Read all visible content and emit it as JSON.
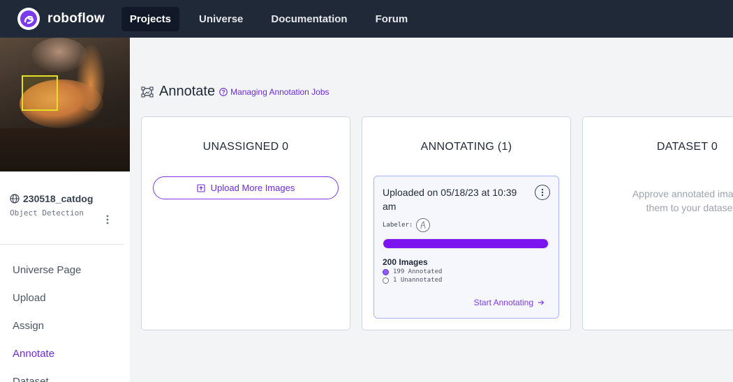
{
  "topbar": {
    "logo_text": "roboflow",
    "nav": [
      {
        "label": "Projects",
        "active": true
      },
      {
        "label": "Universe",
        "active": false
      },
      {
        "label": "Documentation",
        "active": false
      },
      {
        "label": "Forum",
        "active": false
      }
    ]
  },
  "sidebar": {
    "project_name": "230518_catdog",
    "project_type": "Object Detection",
    "menu": [
      {
        "label": "Universe Page",
        "active": false
      },
      {
        "label": "Upload",
        "active": false
      },
      {
        "label": "Assign",
        "active": false
      },
      {
        "label": "Annotate",
        "active": true
      },
      {
        "label": "Dataset",
        "active": false
      }
    ]
  },
  "main": {
    "title": "Annotate",
    "help_link": "Managing Annotation Jobs",
    "columns": {
      "unassigned": {
        "title": "UNASSIGNED 0",
        "upload_label": "Upload More Images"
      },
      "annotating": {
        "title": "ANNOTATING (1)",
        "job": {
          "title": "Uploaded on 05/18/23 at 10:39 am",
          "labeler_label": "Labeler:",
          "progress_fraction": 0.995,
          "images_label": "200 Images",
          "annotated_label": "199 Annotated",
          "unannotated_label": "1 Unannotated",
          "start_label": "Start Annotating"
        }
      },
      "dataset": {
        "title": "DATASET 0",
        "description_line1": "Approve annotated images",
        "description_line2": "them to your dataset"
      }
    }
  },
  "colors": {
    "topbar": "#1f2937",
    "accent": "#7c3aed",
    "progress": "#7c14f0"
  }
}
